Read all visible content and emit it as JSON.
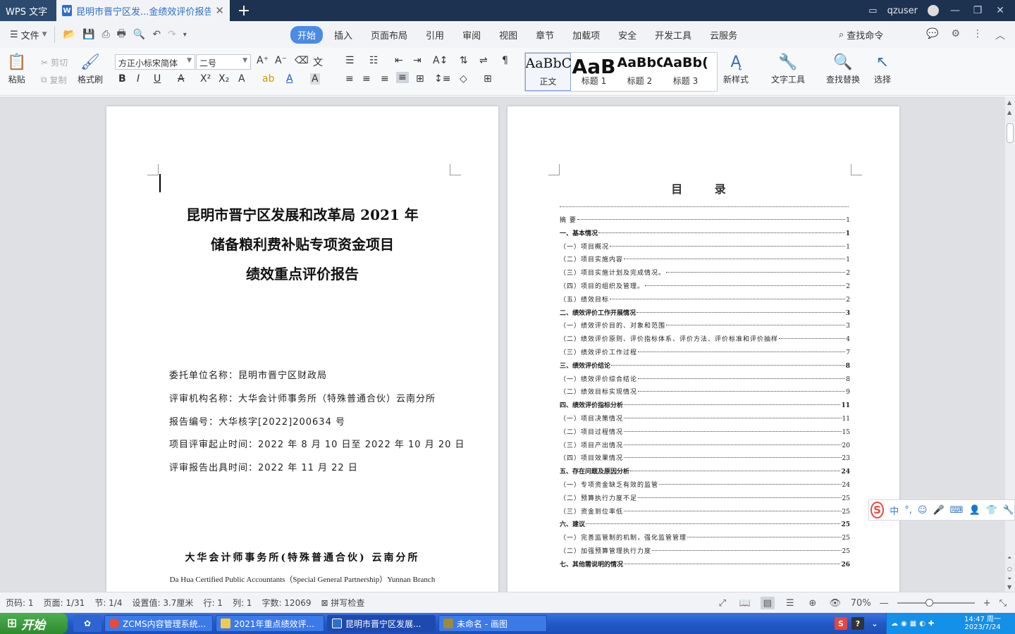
{
  "window": {
    "app_tab": "WPS 文字",
    "doc_tab": "昆明市晋宁区发...金绩效评价报告",
    "user": "qzuser"
  },
  "menubar": {
    "file": "文件",
    "tabs": [
      "开始",
      "插入",
      "页面布局",
      "引用",
      "审阅",
      "视图",
      "章节",
      "加载项",
      "安全",
      "开发工具",
      "云服务"
    ],
    "search": "查找命令"
  },
  "ribbon": {
    "paste": "粘贴",
    "cut": "剪切",
    "copy": "复制",
    "format_painter": "格式刷",
    "font_family": "方正小标宋简体",
    "font_size": "二号",
    "styles": [
      {
        "preview": "AaBbC",
        "name": "正文"
      },
      {
        "preview": "AaB",
        "name": "标题 1"
      },
      {
        "preview": "AaBbC",
        "name": "标题 2"
      },
      {
        "preview": "AaBb(",
        "name": "标题 3"
      }
    ],
    "new_style": "新样式",
    "text_tools": "文字工具",
    "find_replace": "查找替换",
    "select": "选择"
  },
  "page1": {
    "title_lines": [
      "昆明市晋宁区发展和改革局 2021 年",
      "储备粮利费补贴专项资金项目",
      "绩效重点评价报告"
    ],
    "info": [
      "委托单位名称：昆明市晋宁区财政局",
      "评审机构名称：大华会计师事务所（特殊普通合伙）云南分所",
      "报告编号：大华核字[2022]200634 号",
      "项目评审起止时间：2022 年 8 月 10 日至 2022 年 10 月 20 日",
      "评审报告出具时间：2022 年 11 月 22 日"
    ],
    "firm_cn": "大华会计师事务所(特殊普通合伙) 云南分所",
    "firm_en": "Da Hua Certified Public Accountants（Special General Partnership）Yunnan Branch"
  },
  "page2": {
    "toc_title": "目 录",
    "toc": [
      {
        "text": "摘 要",
        "page": "1",
        "level": 2
      },
      {
        "text": "一、基本情况",
        "page": "1",
        "level": 1
      },
      {
        "text": "（一）项目概况",
        "page": "1",
        "level": 2
      },
      {
        "text": "（二）项目实施内容",
        "page": "1",
        "level": 2
      },
      {
        "text": "（三）项目实施计划及完成情况。",
        "page": "2",
        "level": 2
      },
      {
        "text": "（四）项目的组织及管理。",
        "page": "2",
        "level": 2
      },
      {
        "text": "（五）绩效目标",
        "page": "2",
        "level": 2
      },
      {
        "text": "二、绩效评价工作开展情况",
        "page": "3",
        "level": 1
      },
      {
        "text": "（一）绩效评价目的、对象和范围",
        "page": "3",
        "level": 2
      },
      {
        "text": "（二）绩效评价原则、评价指标体系、评价方法、评价标准和评价抽样",
        "page": "4",
        "level": 2
      },
      {
        "text": "（三）绩效评价工作过程",
        "page": "7",
        "level": 2
      },
      {
        "text": "三、绩效评价结论",
        "page": "8",
        "level": 1
      },
      {
        "text": "（一）绩效评价综合结论",
        "page": "8",
        "level": 2
      },
      {
        "text": "（二）绩效目标实现情况",
        "page": "9",
        "level": 2
      },
      {
        "text": "四、绩效评价指标分析",
        "page": "11",
        "level": 1
      },
      {
        "text": "（一）项目决策情况",
        "page": "11",
        "level": 2
      },
      {
        "text": "（二）项目过程情况",
        "page": "15",
        "level": 2
      },
      {
        "text": "（三）项目产出情况",
        "page": "20",
        "level": 2
      },
      {
        "text": "（四）项目效果情况",
        "page": "23",
        "level": 2
      },
      {
        "text": "五、存在问题及原因分析",
        "page": "24",
        "level": 1
      },
      {
        "text": "（一）专项资金缺乏有效的监管",
        "page": "24",
        "level": 2
      },
      {
        "text": "（二）预算执行力度不足",
        "page": "25",
        "level": 2
      },
      {
        "text": "（三）资金到位率低",
        "page": "25",
        "level": 2
      },
      {
        "text": "六、建议",
        "page": "25",
        "level": 1
      },
      {
        "text": "（一）完善监管制的机制，强化监管管理",
        "page": "25",
        "level": 2
      },
      {
        "text": "（二）加强预算管理执行力度",
        "page": "25",
        "level": 2
      },
      {
        "text": "七、其他需说明的情况",
        "page": "26",
        "level": 1
      }
    ]
  },
  "ime": {
    "mode": "中"
  },
  "statusbar": {
    "page_code": "页码: 1",
    "page": "页面: 1/31",
    "section": "节: 1/4",
    "setting": "设置值: 3.7厘米",
    "row": "行: 1",
    "col": "列: 1",
    "words": "字数: 12069",
    "spell": "拼写检查",
    "zoom": "70%"
  },
  "taskbar": {
    "start": "开始",
    "tasks": [
      {
        "label": "ZCMS内容管理系统...",
        "color": "#e94b35"
      },
      {
        "label": "2021年重点绩效评...",
        "color": "#f2c94c"
      },
      {
        "label": "昆明市晋宁区发展...",
        "color": "#2d6fca"
      },
      {
        "label": "未命名 - 画图",
        "color": "#9b8b3a"
      }
    ],
    "time": "14:47 周一",
    "date": "2023/7/24"
  }
}
